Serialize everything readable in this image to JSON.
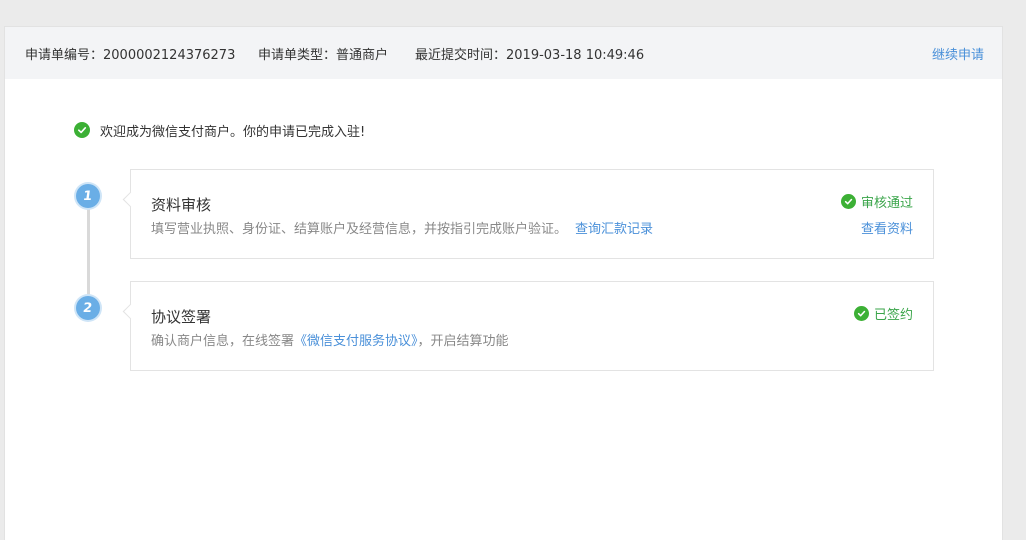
{
  "header": {
    "app_no_label": "申请单编号：",
    "app_no": "2000002124376273",
    "app_type_label": "申请单类型：",
    "app_type": "普通商户",
    "submit_time_label": "最近提交时间：",
    "submit_time": "2019-03-18 10:49:46",
    "continue_link": "继续申请"
  },
  "welcome": {
    "icon": "check-circle-icon",
    "text": "欢迎成为微信支付商户。你的申请已完成入驻!"
  },
  "steps": [
    {
      "number": "1",
      "title": "资料审核",
      "description": "填写营业执照、身份证、结算账户及经营信息，并按指引完成账户验证。",
      "link": "查询汇款记录",
      "status": "审核通过",
      "status_icon": "check-circle-icon",
      "action_link": "查看资料"
    },
    {
      "number": "2",
      "title": "协议签署",
      "description_before": "确认商户信息，在线签署",
      "agreement_link": "《微信支付服务协议》",
      "description_after": "，开启结算功能",
      "status": "已签约",
      "status_icon": "check-circle-icon"
    }
  ],
  "colors": {
    "page_bg": "#ebebeb",
    "header_bg": "#f3f4f6",
    "link": "#4a90d9",
    "success": "#3cb035",
    "success_text": "#3aa54a",
    "step_badge": "#6aaee6",
    "muted_text": "#888888"
  }
}
